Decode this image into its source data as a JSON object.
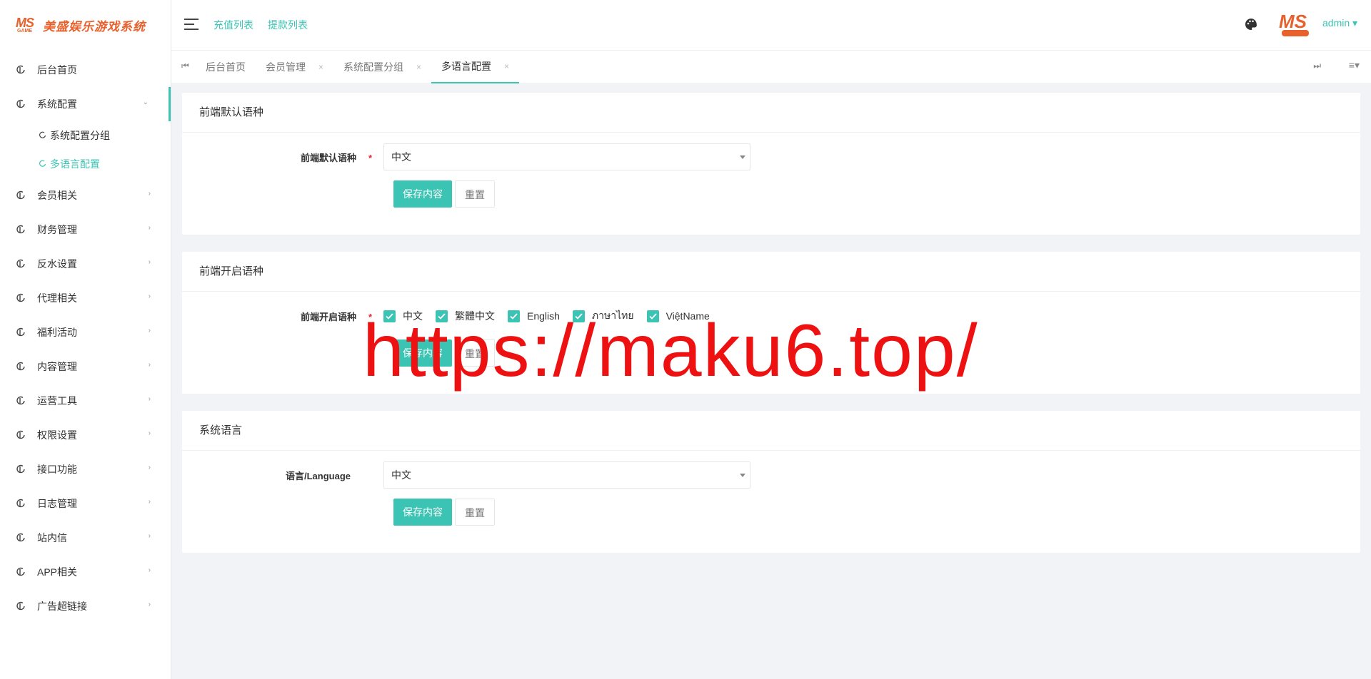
{
  "app": {
    "logo_mark": "MS",
    "logo_sub": "GAME",
    "title": "美盛娱乐游戏系统"
  },
  "header": {
    "links": [
      "充值列表",
      "提款列表"
    ],
    "user": "admin ▾",
    "avatar_text": "MS"
  },
  "sidebar": {
    "items": [
      {
        "label": "后台首页"
      },
      {
        "label": "系统配置",
        "open": true
      },
      {
        "label": "会员相关"
      },
      {
        "label": "财务管理"
      },
      {
        "label": "反水设置"
      },
      {
        "label": "代理相关"
      },
      {
        "label": "福利活动"
      },
      {
        "label": "内容管理"
      },
      {
        "label": "运营工具"
      },
      {
        "label": "权限设置"
      },
      {
        "label": "接口功能"
      },
      {
        "label": "日志管理"
      },
      {
        "label": "站内信"
      },
      {
        "label": "APP相关"
      },
      {
        "label": "广告超链接"
      }
    ],
    "sub_items": [
      {
        "label": "系统配置分组"
      },
      {
        "label": "多语言配置",
        "active": true
      }
    ]
  },
  "tabs": [
    {
      "label": "后台首页",
      "closable": false
    },
    {
      "label": "会员管理",
      "closable": true
    },
    {
      "label": "系统配置分组",
      "closable": true
    },
    {
      "label": "多语言配置",
      "closable": true,
      "active": true
    }
  ],
  "tab_close_glyph": "×",
  "sections": {
    "default_lang": {
      "title": "前端默认语种",
      "label": "前端默认语种",
      "value": "中文",
      "save": "保存内容",
      "reset": "重置"
    },
    "enabled_lang": {
      "title": "前端开启语种",
      "label": "前端开启语种",
      "options": [
        "中文",
        "繁體中文",
        "English",
        "ภาษาไทย",
        "ViệtName"
      ],
      "save": "保存内容",
      "reset": "重置"
    },
    "system_lang": {
      "title": "系统语言",
      "label": "语言/Language",
      "value": "中文",
      "save": "保存内容",
      "reset": "重置"
    }
  },
  "required_mark": "*",
  "watermark": "https://maku6.top/",
  "colors": {
    "accent": "#3bc3b4",
    "logo": "#e8612c",
    "watermark": "#ee1111"
  }
}
